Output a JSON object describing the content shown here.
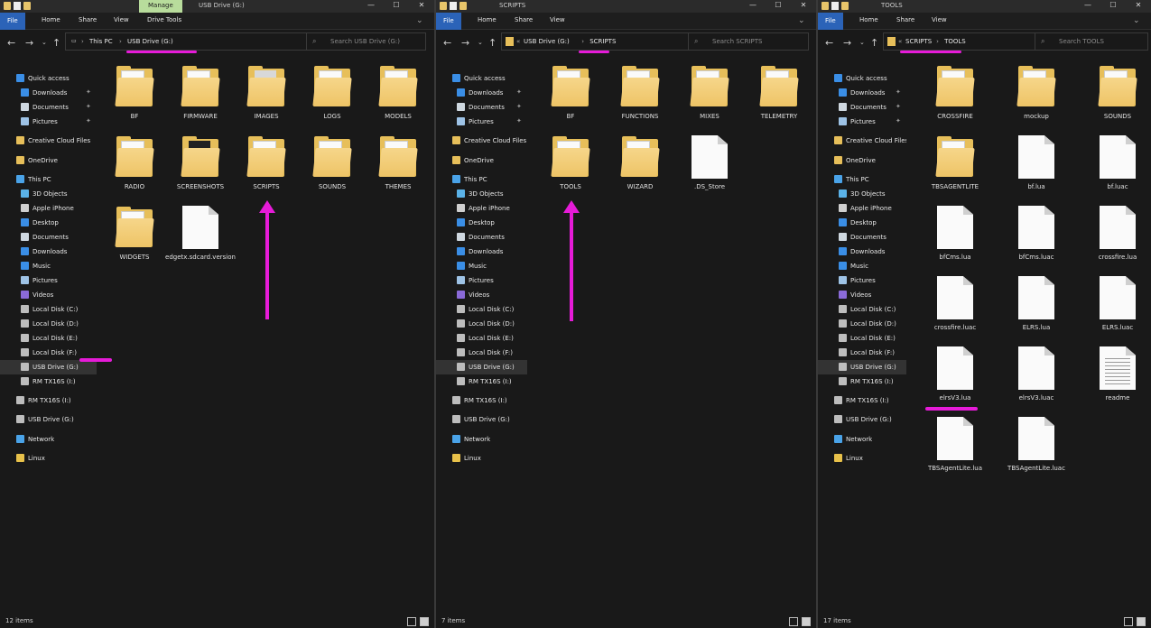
{
  "window1": {
    "title": "USB Drive (G:)",
    "manage_tab": "Manage",
    "tabs": {
      "file": "File",
      "home": "Home",
      "share": "Share",
      "view": "View",
      "drive_tools": "Drive Tools"
    },
    "breadcrumb": {
      "root": "This PC",
      "current": "USB Drive (G:)"
    },
    "search_placeholder": "Search USB Drive (G:)",
    "status": "12 items",
    "items": [
      {
        "name": "BF",
        "type": "folder"
      },
      {
        "name": "FIRMWARE",
        "type": "folder"
      },
      {
        "name": "IMAGES",
        "type": "folder-img"
      },
      {
        "name": "LOGS",
        "type": "folder"
      },
      {
        "name": "MODELS",
        "type": "folder"
      },
      {
        "name": "RADIO",
        "type": "folder"
      },
      {
        "name": "SCREENSHOTS",
        "type": "folder-dark"
      },
      {
        "name": "SCRIPTS",
        "type": "folder"
      },
      {
        "name": "SOUNDS",
        "type": "folder"
      },
      {
        "name": "THEMES",
        "type": "folder"
      },
      {
        "name": "WIDGETS",
        "type": "folder"
      },
      {
        "name": "edgetx.sdcard.version",
        "type": "file"
      }
    ]
  },
  "window2": {
    "title": "SCRIPTS",
    "tabs": {
      "file": "File",
      "home": "Home",
      "share": "Share",
      "view": "View"
    },
    "breadcrumb": {
      "overflow": "«",
      "parent": "USB Drive (G:)",
      "current": "SCRIPTS"
    },
    "search_placeholder": "Search SCRIPTS",
    "status": "7 items",
    "items": [
      {
        "name": "BF",
        "type": "folder"
      },
      {
        "name": "FUNCTIONS",
        "type": "folder"
      },
      {
        "name": "MIXES",
        "type": "folder"
      },
      {
        "name": "TELEMETRY",
        "type": "folder"
      },
      {
        "name": "TOOLS",
        "type": "folder"
      },
      {
        "name": "WIZARD",
        "type": "folder"
      },
      {
        "name": ".DS_Store",
        "type": "file"
      }
    ]
  },
  "window3": {
    "title": "TOOLS",
    "tabs": {
      "file": "File",
      "home": "Home",
      "share": "Share",
      "view": "View"
    },
    "breadcrumb": {
      "overflow": "«",
      "parent": "SCRIPTS",
      "current": "TOOLS"
    },
    "search_placeholder": "Search TOOLS",
    "status": "17 items",
    "items": [
      {
        "name": "CROSSFIRE",
        "type": "folder"
      },
      {
        "name": "mockup",
        "type": "folder"
      },
      {
        "name": "SOUNDS",
        "type": "folder"
      },
      {
        "name": "TBSAGENTLITE",
        "type": "folder"
      },
      {
        "name": "bf.lua",
        "type": "file"
      },
      {
        "name": "bf.luac",
        "type": "file"
      },
      {
        "name": "bfCms.lua",
        "type": "file"
      },
      {
        "name": "bfCms.luac",
        "type": "file"
      },
      {
        "name": "crossfire.lua",
        "type": "file"
      },
      {
        "name": "crossfire.luac",
        "type": "file"
      },
      {
        "name": "ELRS.lua",
        "type": "file"
      },
      {
        "name": "ELRS.luac",
        "type": "file"
      },
      {
        "name": "elrsV3.lua",
        "type": "file"
      },
      {
        "name": "elrsV3.luac",
        "type": "file"
      },
      {
        "name": "readme",
        "type": "text"
      },
      {
        "name": "TBSAgentLite.lua",
        "type": "file"
      },
      {
        "name": "TBSAgentLite.luac",
        "type": "file"
      }
    ]
  },
  "sidebar": {
    "items": [
      {
        "label": "Quick access",
        "icon": "star-icon",
        "color": "#3a8ee6"
      },
      {
        "label": "Downloads",
        "icon": "download-icon",
        "color": "#3a8ee6",
        "pinned": true
      },
      {
        "label": "Documents",
        "icon": "documents-icon",
        "color": "#cfd8e0",
        "pinned": true
      },
      {
        "label": "Pictures",
        "icon": "pictures-icon",
        "color": "#9ec3e6",
        "pinned": true
      },
      {
        "label": "Creative Cloud Files",
        "icon": "folder-icon",
        "color": "#e7bf5a"
      },
      {
        "label": "OneDrive",
        "icon": "folder-icon",
        "color": "#e7bf5a"
      },
      {
        "label": "This PC",
        "icon": "pc-icon",
        "color": "#4aa3e8"
      },
      {
        "label": "3D Objects",
        "icon": "cube-icon",
        "color": "#5ab2e8"
      },
      {
        "label": "Apple iPhone",
        "icon": "phone-icon",
        "color": "#cfcfcf"
      },
      {
        "label": "Desktop",
        "icon": "desktop-icon",
        "color": "#3a8ee6"
      },
      {
        "label": "Documents",
        "icon": "documents-icon",
        "color": "#cfd8e0"
      },
      {
        "label": "Downloads",
        "icon": "download-icon",
        "color": "#3a8ee6"
      },
      {
        "label": "Music",
        "icon": "music-icon",
        "color": "#3a8ee6"
      },
      {
        "label": "Pictures",
        "icon": "pictures-icon",
        "color": "#9ec3e6"
      },
      {
        "label": "Videos",
        "icon": "videos-icon",
        "color": "#8a6ad8"
      },
      {
        "label": "Local Disk (C:)",
        "icon": "drive-icon",
        "color": "#bdbdbd"
      },
      {
        "label": "Local Disk (D:)",
        "icon": "drive-icon",
        "color": "#bdbdbd"
      },
      {
        "label": "Local Disk (E:)",
        "icon": "drive-icon",
        "color": "#bdbdbd"
      },
      {
        "label": "Local Disk (F:)",
        "icon": "drive-icon",
        "color": "#bdbdbd"
      },
      {
        "label": "USB Drive (G:)",
        "icon": "usb-drive-icon",
        "color": "#bdbdbd",
        "selected": true
      },
      {
        "label": "RM TX16S (I:)",
        "icon": "usb-drive-icon",
        "color": "#bdbdbd"
      },
      {
        "label": "RM TX16S (I:)",
        "icon": "usb-drive-icon",
        "color": "#bdbdbd"
      },
      {
        "label": "USB Drive (G:)",
        "icon": "usb-drive-icon",
        "color": "#bdbdbd"
      },
      {
        "label": "Network",
        "icon": "network-icon",
        "color": "#4aa3e8"
      },
      {
        "label": "Linux",
        "icon": "linux-icon",
        "color": "#e8c14a"
      }
    ]
  },
  "colors": {
    "highlight": "#e61bd8",
    "file_tab": "#2b63b8",
    "manage_tab": "#b8dc9c"
  }
}
